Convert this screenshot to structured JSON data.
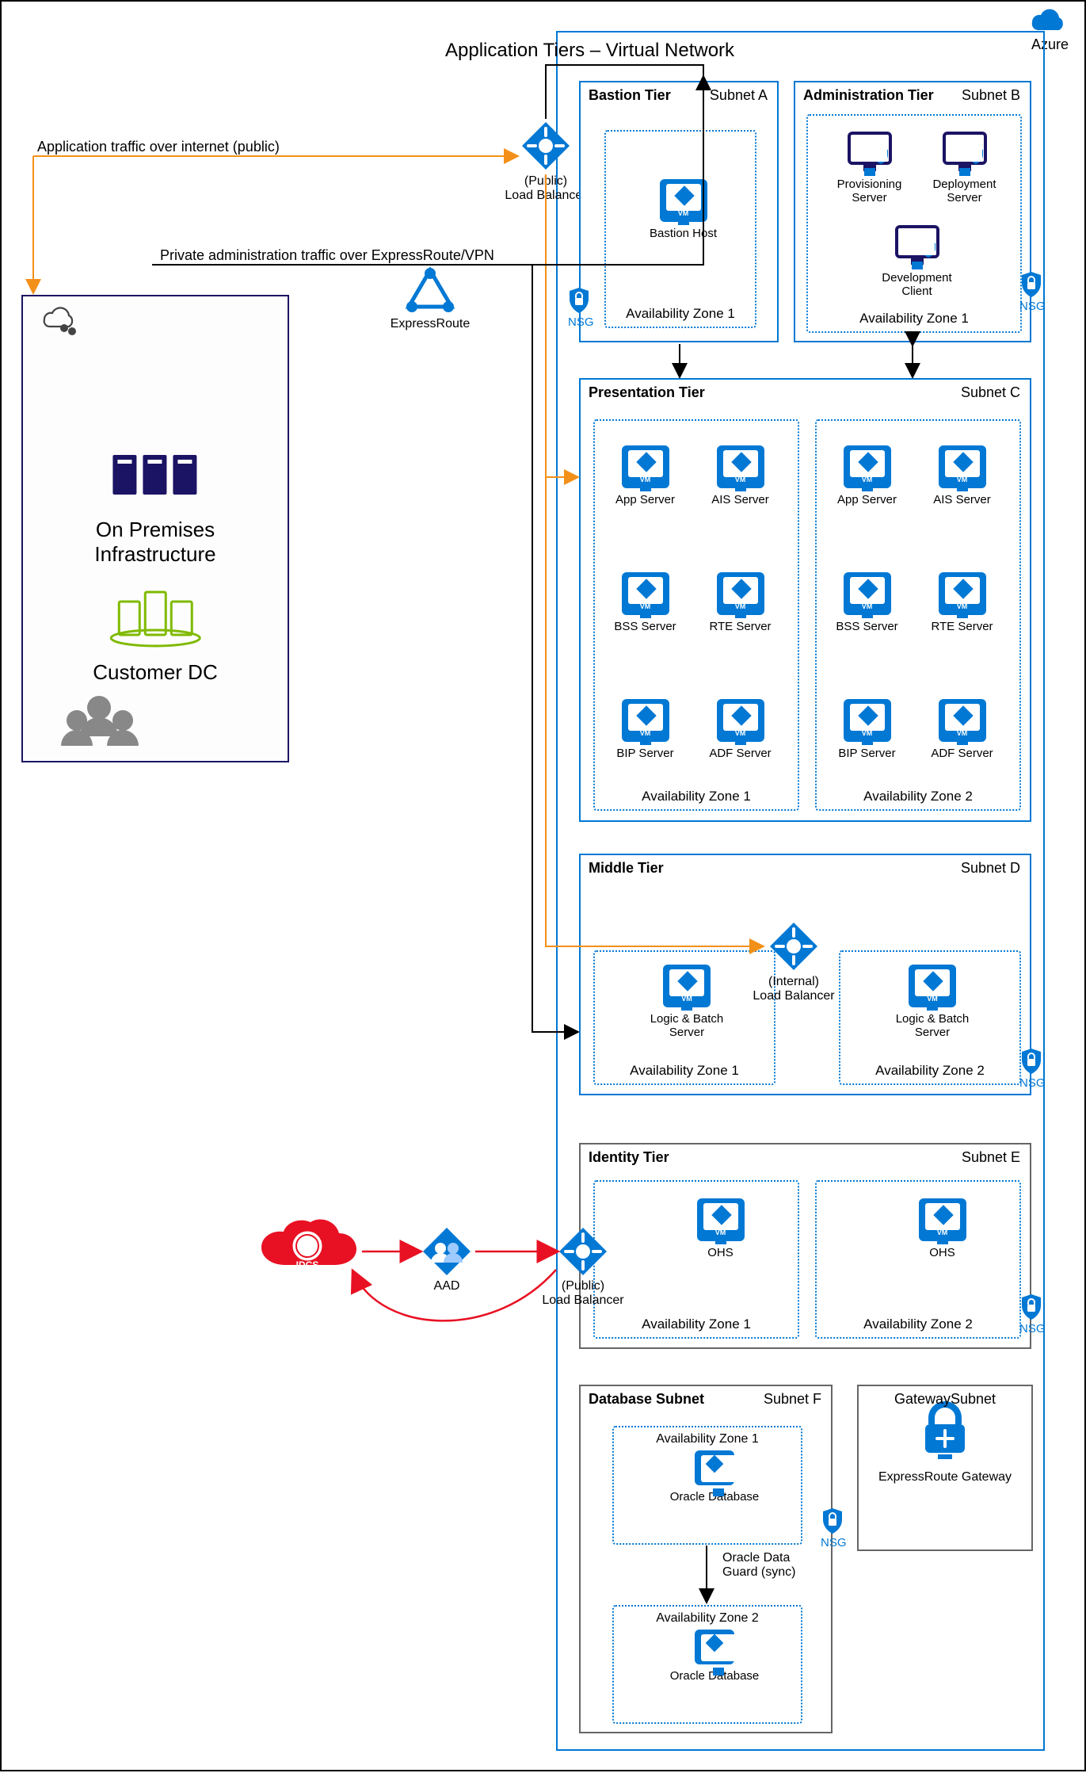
{
  "brand": "Azure",
  "vnetTitle": "Application Tiers – Virtual Network",
  "trafficPublic": "Application traffic over internet (public)",
  "trafficPrivate": "Private administration traffic over ExpressRoute/VPN",
  "publicLB": "(Public)\nLoad Balancer",
  "expressRoute": "ExpressRoute",
  "onprem": {
    "infra": "On Premises\nInfrastructure",
    "dc": "Customer DC"
  },
  "tiers": {
    "bastion": {
      "title": "Bastion Tier",
      "subnet": "Subnet A",
      "az": "Availability Zone 1",
      "host": "Bastion Host",
      "nsg": "NSG"
    },
    "admin": {
      "title": "Administration Tier",
      "subnet": "Subnet B",
      "az": "Availability Zone 1",
      "nodes": [
        "Provisioning\nServer",
        "Deployment\nServer",
        "Development\nClient"
      ],
      "nsg": "NSG"
    },
    "presentation": {
      "title": "Presentation Tier",
      "subnet": "Subnet C",
      "az1": "Availability Zone 1",
      "az2": "Availability Zone 2",
      "nodes": [
        "App Server",
        "AIS Server",
        "BSS Server",
        "RTE Server",
        "BIP Server",
        "ADF Server"
      ]
    },
    "middle": {
      "title": "Middle Tier",
      "subnet": "Subnet D",
      "lb": "(Internal)\nLoad Balancer",
      "node": "Logic & Batch Server",
      "az1": "Availability Zone 1",
      "az2": "Availability Zone 2",
      "nsg": "NSG"
    },
    "identity": {
      "title": "Identity Tier",
      "subnet": "Subnet E",
      "lb": "(Public)\nLoad Balancer",
      "node": "OHS",
      "az1": "Availability Zone 1",
      "az2": "Availability Zone 2",
      "nsg": "NSG"
    },
    "database": {
      "title": "Database Subnet",
      "subnet": "Subnet F",
      "az1": "Availability Zone 1",
      "az2": "Availability Zone 2",
      "node": "Oracle Database",
      "sync": "Oracle Data\nGuard (sync)",
      "nsg": "NSG"
    },
    "gateway": {
      "title": "GatewaySubnet",
      "node": "ExpressRoute Gateway"
    }
  },
  "idcs": "IDCS",
  "aad": "AAD"
}
